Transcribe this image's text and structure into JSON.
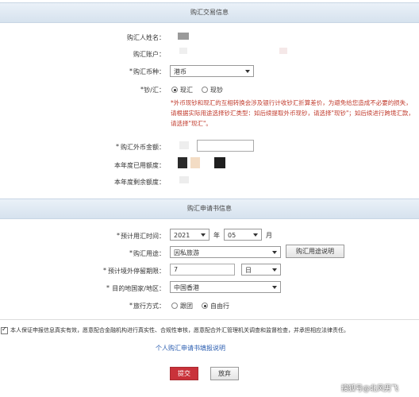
{
  "section1": {
    "title": "购汇交易信息",
    "name_label": "购汇人姓名：",
    "account_label": "购汇账户：",
    "currency_label": "购汇币种：",
    "currency_value": "港币",
    "cashtype_label": "钞/汇：",
    "cashtype_options": [
      "现汇",
      "现钞"
    ],
    "warning": "*外币现钞和现汇的互相转换会涉及银行计收钞汇折算差价，为避免给您造成不必要的损失，请根据实际用途选择钞汇类型：如后续提取外币现钞，请选择\"现钞\"；如后续进行跨境汇款，请选择\"现汇\"。",
    "amount_label": "购汇外币金额：",
    "used_label": "本年度已用额度：",
    "remaining_label": "本年度剩余额度："
  },
  "section2": {
    "title": "购汇申请书信息",
    "date_label": "预计用汇时间：",
    "year_value": "2021",
    "year_unit": "年",
    "month_value": "05",
    "month_unit": "月",
    "purpose_label": "购汇用途：",
    "purpose_value": "因私旅游",
    "purpose_help_button": "购汇用途说明",
    "stay_label": "预计境外停留期限：",
    "stay_value": "7",
    "stay_unit": "日",
    "dest_label": "目的地国家/地区：",
    "dest_value": "中国香港",
    "travel_label": "旅行方式：",
    "travel_options": [
      "跟团",
      "自由行"
    ]
  },
  "declaration": "本人保证申报信息真实有效，愿意配合金融机构进行真实性、合规性审核，愿意配合外汇管理机关调查和监督检查，并承担相应法律责任。",
  "guide_link": "个人购汇申请书填报说明",
  "buttons": {
    "submit": "提交",
    "cancel": "放弃"
  },
  "watermark": "搜狐号@北风男飞",
  "colors": {
    "submit_bg": "#c9323a",
    "warning": "#c0392b",
    "header_bg": "#dfe8f1"
  }
}
